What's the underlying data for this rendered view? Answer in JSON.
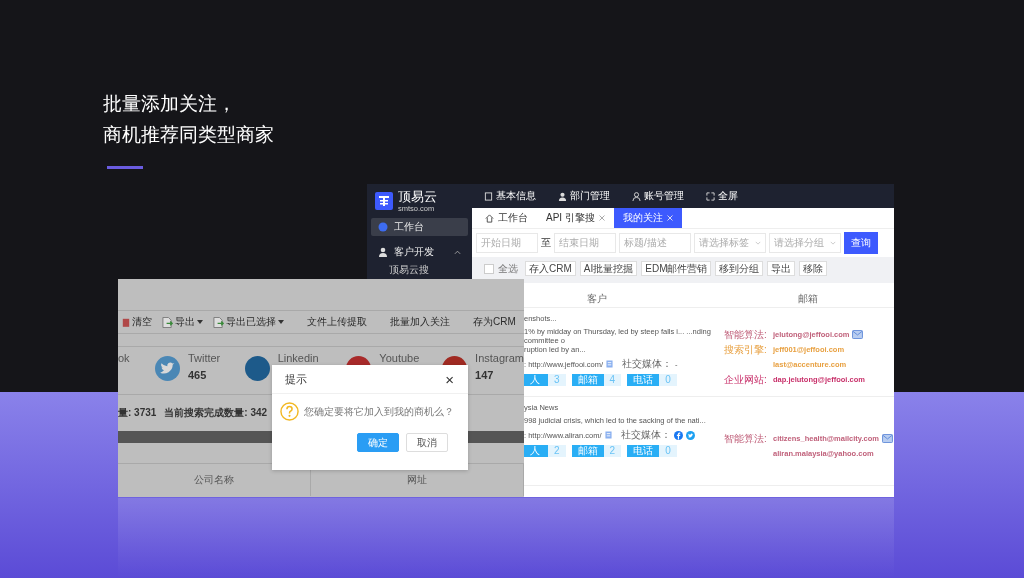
{
  "headline": {
    "lines": [
      "批量添加关注，",
      "商机推荐同类型商家"
    ]
  },
  "app": {
    "logo": {
      "name": "顶易云",
      "domain": "smtso.com"
    },
    "sidebar": {
      "items": [
        {
          "label": "工作台",
          "selected": true
        },
        {
          "label": "客户开发",
          "selected": false,
          "expanded": true,
          "children": [
            {
              "label": "顶易云搜",
              "selected": false
            }
          ]
        }
      ]
    },
    "topnav": [
      "基本信息",
      "部门管理",
      "账号管理",
      "全屏"
    ],
    "tabs": [
      {
        "label": "工作台",
        "selected": false,
        "closable": false
      },
      {
        "label": "API 引擎搜",
        "selected": false,
        "closable": true
      },
      {
        "label": "我的关注",
        "selected": true,
        "closable": true
      }
    ],
    "filters": {
      "start_date": {
        "placeholder": "开始日期"
      },
      "separator": "至",
      "end_date": {
        "placeholder": "结束日期"
      },
      "keyword": {
        "placeholder": "标题/描述"
      },
      "tag": {
        "placeholder": "请选择标签"
      },
      "group": {
        "placeholder": "请选择分组"
      },
      "search_button": "查询"
    },
    "actions": {
      "select_all": {
        "label": "全选",
        "checked": false
      },
      "buttons": [
        "存入CRM",
        "AI批量挖掘",
        "EDM邮件营销",
        "移到分组",
        "导出",
        "移除"
      ]
    },
    "table": {
      "columns": [
        "客户",
        "邮箱"
      ],
      "rows": [
        {
          "title": "enshots...",
          "description": [
            "1% by midday on Thursday, led by steep falls i...  ...nding committee o",
            "ruption led by an..."
          ],
          "website": ": http://www.jeffooi.com/",
          "social_label": "社交媒体：",
          "social": "-",
          "counts": [
            {
              "label": "人",
              "value": "3"
            },
            {
              "label": "邮箱",
              "value": "4"
            },
            {
              "label": "电话",
              "value": "0"
            }
          ],
          "emails": [
            {
              "source": "智能算法:",
              "address": "jelutong@jeffooi.com",
              "color": "#c0607a"
            },
            {
              "source": "搜索引擎:",
              "address": "jeff001@jeffooi.com",
              "color": "#e8a040"
            },
            {
              "address": "last@accenture.com",
              "color": "#e8a040"
            },
            {
              "source": "企业网站:",
              "address": "dap.jelutong@jeffooi.com",
              "color": "#c8306a"
            }
          ]
        },
        {
          "title": "ysia News",
          "description": [
            "998 judicial crisis, which led to the sacking of the nati..."
          ],
          "website": ": http://www.aliran.com/",
          "social_label": "社交媒体：",
          "social_icons": [
            {
              "kind": "facebook"
            },
            {
              "kind": "twitter"
            }
          ],
          "counts": [
            {
              "label": "人",
              "value": "2"
            },
            {
              "label": "邮箱",
              "value": "2"
            },
            {
              "label": "电话",
              "value": "0"
            }
          ],
          "emails": [
            {
              "source": "智能算法:",
              "address": "citizens_health@mailcity.com",
              "color": "#c0607a"
            },
            {
              "address": "aliran.malaysia@yahoo.com",
              "color": "#c0607a"
            }
          ]
        }
      ]
    }
  },
  "overlay_screenshot": {
    "toolbar": [
      {
        "label": "清空",
        "kind": "clear",
        "dropdown": false
      },
      {
        "label": "导出",
        "kind": "export",
        "dropdown": true
      },
      {
        "label": "导出已选择",
        "kind": "export",
        "dropdown": true
      },
      {
        "label": "文件上传提取",
        "kind": "text",
        "dropdown": false
      },
      {
        "label": "批量加入关注",
        "kind": "text",
        "dropdown": false
      },
      {
        "label": "存为CRM",
        "kind": "text",
        "dropdown": false
      }
    ],
    "socials": [
      {
        "name": "ok"
      },
      {
        "name": "Twitter",
        "count": "465",
        "color": "#4a87b5"
      },
      {
        "name": "Linkedin",
        "color": "#1d5a8a"
      },
      {
        "name": "Youtube",
        "color": "#a82a2a"
      },
      {
        "name": "Instagram",
        "count": "147",
        "color": "#a02a22"
      }
    ],
    "stats": [
      "量: 3731",
      "当前搜索完成数量: 342"
    ],
    "table": {
      "columns": [
        "公司名称",
        "网址"
      ]
    },
    "dialog": {
      "title": "提示",
      "close": "×",
      "message": "您确定要将它加入到我的商机么？",
      "buttons": [
        {
          "label": "确定",
          "kind": "primary"
        },
        {
          "label": "取消",
          "kind": "default"
        }
      ]
    }
  }
}
